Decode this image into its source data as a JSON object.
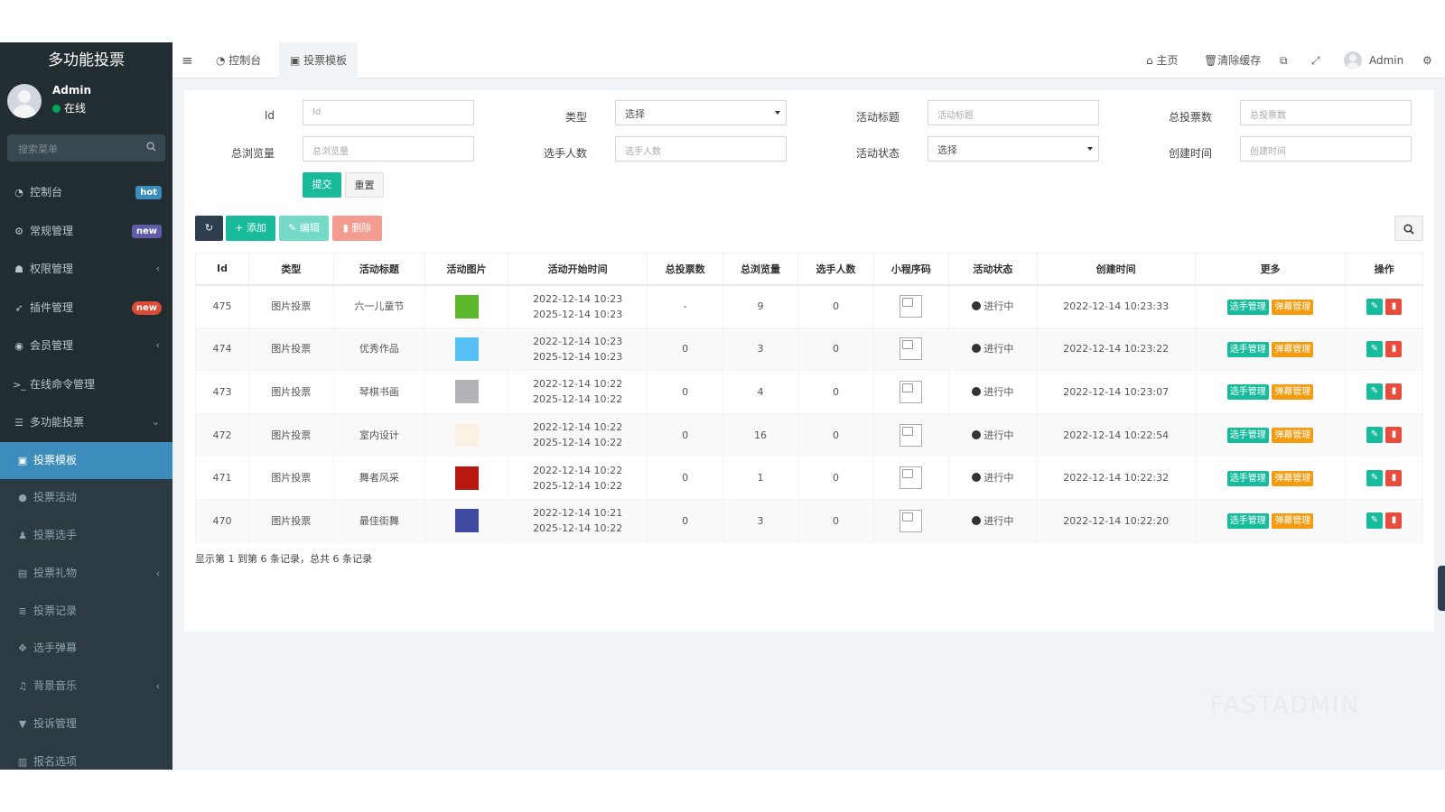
{
  "app": {
    "title": "多功能投票"
  },
  "user": {
    "name": "Admin",
    "status": "在线"
  },
  "sidebar_search": {
    "placeholder": "搜索菜单"
  },
  "menu": [
    {
      "label": "控制台",
      "icon": "dashboard-icon",
      "badge": "hot"
    },
    {
      "label": "常规管理",
      "icon": "cogs-icon",
      "badge": "new"
    },
    {
      "label": "权限管理",
      "icon": "group-icon",
      "arrow": "‹"
    },
    {
      "label": "插件管理",
      "icon": "rocket-icon",
      "badge": "new"
    },
    {
      "label": "会员管理",
      "icon": "user-circle-icon",
      "arrow": "‹"
    },
    {
      "label": "在线命令管理",
      "icon": "terminal-icon"
    },
    {
      "label": "多功能投票",
      "icon": "list-icon",
      "arrow": "⌄"
    }
  ],
  "submenu": [
    {
      "label": "投票模板",
      "icon": "image-icon",
      "active": true
    },
    {
      "label": "投票活动",
      "icon": "bomb-icon"
    },
    {
      "label": "投票选手",
      "icon": "users-icon"
    },
    {
      "label": "投票礼物",
      "icon": "archive-icon",
      "arrow": "‹"
    },
    {
      "label": "投票记录",
      "icon": "list-ol-icon"
    },
    {
      "label": "选手弹幕",
      "icon": "arrows-icon"
    },
    {
      "label": "背景音乐",
      "icon": "music-icon",
      "arrow": "‹"
    },
    {
      "label": "投诉管理",
      "icon": "bookmark-icon"
    },
    {
      "label": "报名选项",
      "icon": "columns-icon"
    }
  ],
  "topnav": {
    "tab_dashboard": "控制台",
    "tab_template": "投票模板",
    "home": "主页",
    "clear_cache": "清除缓存",
    "admin": "Admin"
  },
  "filters": {
    "id_label": "Id",
    "id_placeholder": "Id",
    "type_label": "类型",
    "type_value": "选择",
    "title_label": "活动标题",
    "title_placeholder": "活动标题",
    "votes_label": "总投票数",
    "votes_placeholder": "总投票数",
    "views_label": "总浏览量",
    "views_placeholder": "总浏览量",
    "players_label": "选手人数",
    "players_placeholder": "选手人数",
    "status_label": "活动状态",
    "status_value": "选择",
    "created_label": "创建时间",
    "created_placeholder": "创建时间",
    "submit": "提交",
    "reset": "重置"
  },
  "toolbar": {
    "add": "添加",
    "edit": "编辑",
    "delete": "删除"
  },
  "table": {
    "headers": [
      "Id",
      "类型",
      "活动标题",
      "活动图片",
      "活动开始时间",
      "总投票数",
      "总浏览量",
      "选手人数",
      "小程序码",
      "活动状态",
      "创建时间",
      "更多",
      "操作"
    ],
    "rows": [
      {
        "id": "475",
        "type": "图片投票",
        "title": "六一儿童节",
        "color": "#5cb82a",
        "start": "2022-12-14 10:23",
        "end": "2025-12-14 10:23",
        "votes": "-",
        "views": "9",
        "players": "0",
        "status": "进行中",
        "created": "2022-12-14 10:23:33"
      },
      {
        "id": "474",
        "type": "图片投票",
        "title": "优秀作品",
        "color": "#56bff5",
        "start": "2022-12-14 10:23",
        "end": "2025-12-14 10:23",
        "votes": "0",
        "views": "3",
        "players": "0",
        "status": "进行中",
        "created": "2022-12-14 10:23:22"
      },
      {
        "id": "473",
        "type": "图片投票",
        "title": "琴棋书画",
        "color": "#b4b4b8",
        "start": "2022-12-14 10:22",
        "end": "2025-12-14 10:22",
        "votes": "0",
        "views": "4",
        "players": "0",
        "status": "进行中",
        "created": "2022-12-14 10:23:07"
      },
      {
        "id": "472",
        "type": "图片投票",
        "title": "室内设计",
        "color": "#fbf1e4",
        "start": "2022-12-14 10:22",
        "end": "2025-12-14 10:22",
        "votes": "0",
        "views": "16",
        "players": "0",
        "status": "进行中",
        "created": "2022-12-14 10:22:54"
      },
      {
        "id": "471",
        "type": "图片投票",
        "title": "舞者风采",
        "color": "#b8170f",
        "start": "2022-12-14 10:22",
        "end": "2025-12-14 10:22",
        "votes": "0",
        "views": "1",
        "players": "0",
        "status": "进行中",
        "created": "2022-12-14 10:22:32"
      },
      {
        "id": "470",
        "type": "图片投票",
        "title": "最佳街舞",
        "color": "#3f4aa1",
        "start": "2022-12-14 10:21",
        "end": "2025-12-14 10:22",
        "votes": "0",
        "views": "3",
        "players": "0",
        "status": "进行中",
        "created": "2022-12-14 10:22:20"
      }
    ],
    "more_player": "选手管理",
    "more_barrage": "弹幕管理"
  },
  "pager": "显示第 1 到第 6 条记录，总共 6 条记录",
  "watermark": "FASTADMIN",
  "colors": {
    "sidebar": "#222d32",
    "accent": "#3c8dbc",
    "green": "#18bc9c",
    "orange": "#f39c12",
    "red": "#e74c3c"
  }
}
